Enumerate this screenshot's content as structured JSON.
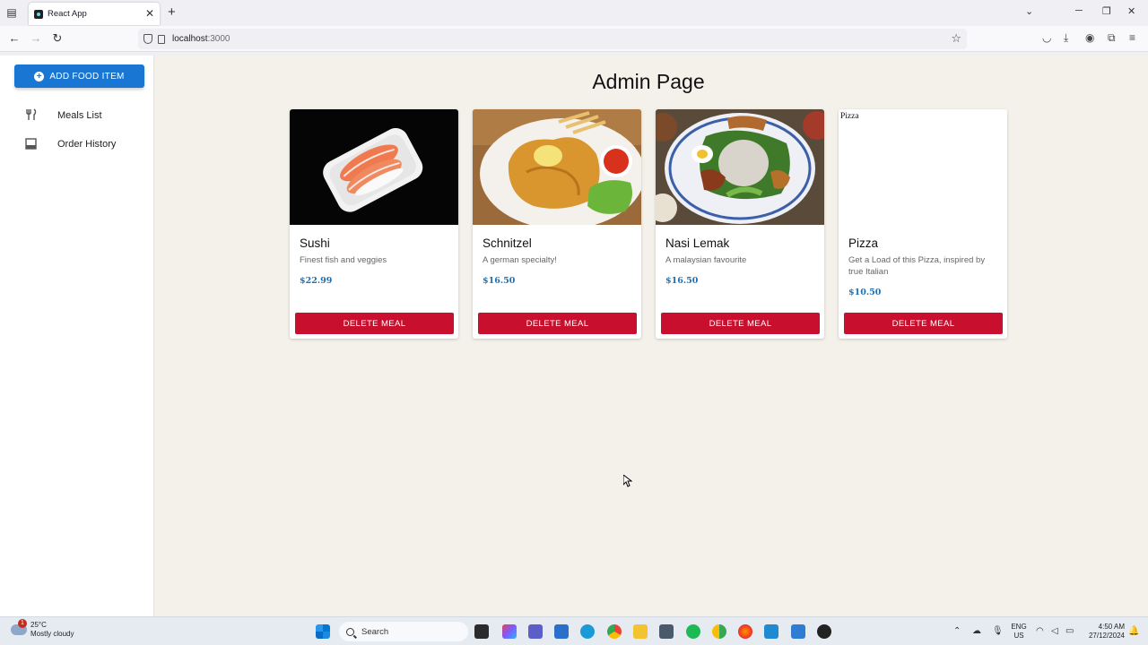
{
  "browser": {
    "tab_title": "React App",
    "url_host": "localhost",
    "url_port": ":3000"
  },
  "sidebar": {
    "add_button_label": "ADD FOOD ITEM",
    "items": [
      {
        "label": "Meals List",
        "icon": "fork-knife-icon"
      },
      {
        "label": "Order History",
        "icon": "inbox-icon"
      }
    ]
  },
  "main": {
    "title": "Admin Page",
    "delete_label": "DELETE MEAL",
    "meals": [
      {
        "name": "Sushi",
        "description": "Finest fish and veggies",
        "price": "$22.99"
      },
      {
        "name": "Schnitzel",
        "description": "A german specialty!",
        "price": "$16.50"
      },
      {
        "name": "Nasi Lemak",
        "description": "A malaysian favourite",
        "price": "$16.50"
      },
      {
        "name": "Pizza",
        "description": "Get a Load of this Pizza, inspired by true Italian",
        "price": "$10.50",
        "image_alt": "Pizza"
      }
    ]
  },
  "taskbar": {
    "temperature": "25°C",
    "weather": "Mostly cloudy",
    "weather_badge": "1",
    "search_placeholder": "Search",
    "lang_top": "ENG",
    "lang_bottom": "US",
    "time": "4:50 AM",
    "date": "27/12/2024"
  },
  "colors": {
    "primary": "#1976d2",
    "danger": "#c8102e",
    "price": "#1f6fb5",
    "page_bg": "#f3f1ea"
  }
}
